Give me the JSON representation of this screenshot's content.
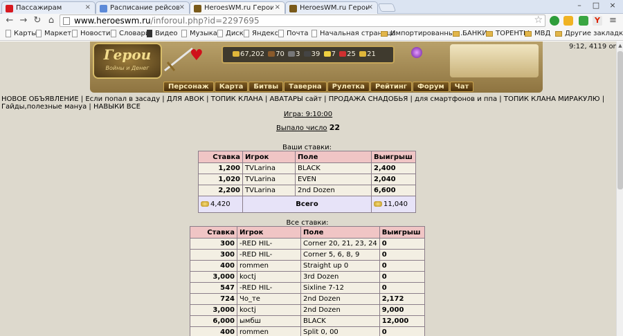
{
  "tabs": [
    {
      "label": "Пассажирам",
      "color": "#d71920"
    },
    {
      "label": "Расписание рейсов из Уф",
      "color": "#5d8ad8"
    },
    {
      "label": "HeroesWM.ru Герои войн",
      "color": "#7a5a1a"
    },
    {
      "label": "HeroesWM.ru Герои войн",
      "color": "#7a5a1a"
    }
  ],
  "url": {
    "host": "www.heroeswm.ru",
    "path": "/inforoul.php?id=2297695"
  },
  "bookmarks": [
    {
      "label": "Карты",
      "folder": false
    },
    {
      "label": "Маркет",
      "folder": false
    },
    {
      "label": "Новости",
      "folder": false
    },
    {
      "label": "Словари",
      "folder": false
    },
    {
      "label": "Видео",
      "folder": false
    },
    {
      "label": "Музыка",
      "folder": false
    },
    {
      "label": "Диск",
      "folder": false
    },
    {
      "label": "Яндекс",
      "folder": false
    },
    {
      "label": "Почта",
      "folder": false
    },
    {
      "label": "Начальная страница",
      "folder": false
    },
    {
      "label": "Импортированные ...",
      "folder": true
    },
    {
      "label": "БАНКИ",
      "folder": true
    },
    {
      "label": "ТОРЕНТЫ",
      "folder": true
    },
    {
      "label": "МВД",
      "folder": true
    },
    {
      "label": "Другие закладки",
      "folder": true
    }
  ],
  "logo": {
    "line1": "Герои",
    "line2": "Войны и Денег"
  },
  "resources": [
    {
      "value": "67,202",
      "color": "#e0b63a"
    },
    {
      "value": "70",
      "color": "#8a5a2a"
    },
    {
      "value": "3",
      "color": "#777777"
    },
    {
      "value": "39",
      "color": "#444444"
    },
    {
      "value": "7",
      "color": "#f0d040"
    },
    {
      "value": "25",
      "color": "#d03030"
    },
    {
      "value": "21",
      "color": "#e0b63a"
    }
  ],
  "online": "9:12, 4119 online",
  "menu": [
    "Персонаж",
    "Карта",
    "Битвы",
    "Таверна",
    "Рулетка",
    "Рейтинг",
    "Форум",
    "Чат"
  ],
  "news_links": "НОВОЕ ОБЪЯВЛЕНИЕ | Если попал в засаду | ДЛЯ АВОК | ТОПИК КЛАНА | АВАТАРЫ сайт | ПРОДАЖА СНАДОБЬЯ | для смартфонов и ппа | ТОПИК КЛАНА МИРАКУЛЮ | Гайды,полезные мануа | НАВЫКИ ВСЕ",
  "game": {
    "label": "Игра: 9:10:00",
    "result_label": "Выпало число",
    "result_number": "22"
  },
  "my_bets": {
    "caption": "Ваши ставки:",
    "headers": [
      "Ставка",
      "Игрок",
      "Поле",
      "Выигрыш"
    ],
    "rows": [
      {
        "bet": "1,200",
        "player": "TVLarina",
        "field": "BLACK",
        "win": "2,400"
      },
      {
        "bet": "1,020",
        "player": "TVLarina",
        "field": "EVEN",
        "win": "2,040"
      },
      {
        "bet": "2,200",
        "player": "TVLarina",
        "field": "2nd Dozen",
        "win": "6,600"
      }
    ],
    "total": {
      "bet": "4,420",
      "label": "Всего",
      "win": "11,040"
    }
  },
  "all_bets": {
    "caption": "Все ставки:",
    "headers": [
      "Ставка",
      "Игрок",
      "Поле",
      "Выигрыш"
    ],
    "rows": [
      {
        "bet": "300",
        "player": "-RED HIL-",
        "field": "Corner 20, 21, 23, 24",
        "win": "0"
      },
      {
        "bet": "300",
        "player": "-RED HIL-",
        "field": "Corner 5, 6, 8, 9",
        "win": "0"
      },
      {
        "bet": "400",
        "player": "rommen",
        "field": "Straight up 0",
        "win": "0"
      },
      {
        "bet": "3,000",
        "player": "koctj",
        "field": "3rd Dozen",
        "win": "0"
      },
      {
        "bet": "547",
        "player": "-RED HIL-",
        "field": "Sixline 7-12",
        "win": "0"
      },
      {
        "bet": "724",
        "player": "Чо_те",
        "field": "2nd Dozen",
        "win": "2,172"
      },
      {
        "bet": "3,000",
        "player": "koctj",
        "field": "2nd Dozen",
        "win": "9,000"
      },
      {
        "bet": "6,000",
        "player": "ымбш",
        "field": "BLACK",
        "win": "12,000"
      },
      {
        "bet": "400",
        "player": "rommen",
        "field": "Split 0, 00",
        "win": "0"
      }
    ]
  }
}
